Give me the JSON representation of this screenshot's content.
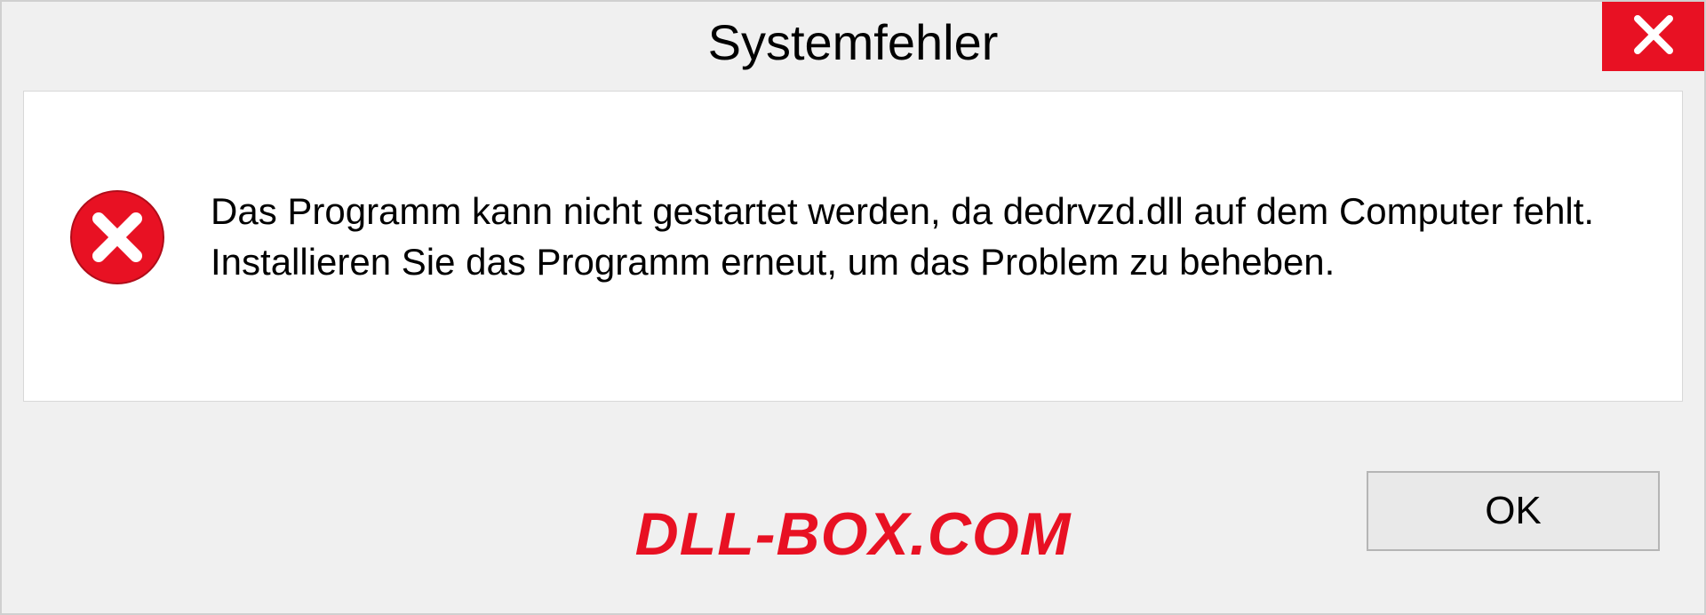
{
  "dialog": {
    "title": "Systemfehler",
    "message": "Das Programm kann nicht gestartet werden, da dedrvzd.dll auf dem Computer fehlt. Installieren Sie das Programm erneut, um das Problem zu beheben.",
    "ok_label": "OK"
  },
  "watermark": "DLL-BOX.COM"
}
